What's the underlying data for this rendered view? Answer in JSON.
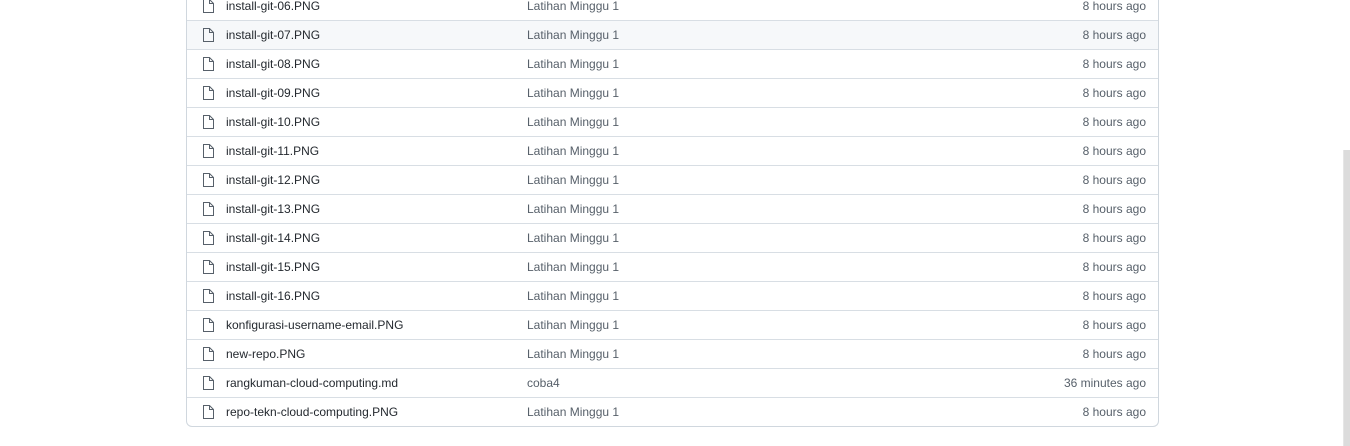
{
  "files": [
    {
      "name": "install-git-06.PNG",
      "commit": "Latihan Minggu 1",
      "age": "8 hours ago",
      "icon": "file-icon"
    },
    {
      "name": "install-git-07.PNG",
      "commit": "Latihan Minggu 1",
      "age": "8 hours ago",
      "icon": "file-icon"
    },
    {
      "name": "install-git-08.PNG",
      "commit": "Latihan Minggu 1",
      "age": "8 hours ago",
      "icon": "file-icon"
    },
    {
      "name": "install-git-09.PNG",
      "commit": "Latihan Minggu 1",
      "age": "8 hours ago",
      "icon": "file-icon"
    },
    {
      "name": "install-git-10.PNG",
      "commit": "Latihan Minggu 1",
      "age": "8 hours ago",
      "icon": "file-icon"
    },
    {
      "name": "install-git-11.PNG",
      "commit": "Latihan Minggu 1",
      "age": "8 hours ago",
      "icon": "file-icon"
    },
    {
      "name": "install-git-12.PNG",
      "commit": "Latihan Minggu 1",
      "age": "8 hours ago",
      "icon": "file-icon"
    },
    {
      "name": "install-git-13.PNG",
      "commit": "Latihan Minggu 1",
      "age": "8 hours ago",
      "icon": "file-icon"
    },
    {
      "name": "install-git-14.PNG",
      "commit": "Latihan Minggu 1",
      "age": "8 hours ago",
      "icon": "file-icon"
    },
    {
      "name": "install-git-15.PNG",
      "commit": "Latihan Minggu 1",
      "age": "8 hours ago",
      "icon": "file-icon"
    },
    {
      "name": "install-git-16.PNG",
      "commit": "Latihan Minggu 1",
      "age": "8 hours ago",
      "icon": "file-icon"
    },
    {
      "name": "konfigurasi-username-email.PNG",
      "commit": "Latihan Minggu 1",
      "age": "8 hours ago",
      "icon": "file-icon"
    },
    {
      "name": "new-repo.PNG",
      "commit": "Latihan Minggu 1",
      "age": "8 hours ago",
      "icon": "file-icon"
    },
    {
      "name": "rangkuman-cloud-computing.md",
      "commit": "coba4",
      "age": "36 minutes ago",
      "icon": "file-icon"
    },
    {
      "name": "repo-tekn-cloud-computing.PNG",
      "commit": "Latihan Minggu 1",
      "age": "8 hours ago",
      "icon": "file-icon"
    }
  ],
  "hovered_row": "install-git-07.PNG",
  "colors": {
    "border": "#d0d7de",
    "row_divider": "#d8dee4",
    "hover_bg": "#f6f8fa",
    "text": "#24292f",
    "muted": "#57606a"
  }
}
